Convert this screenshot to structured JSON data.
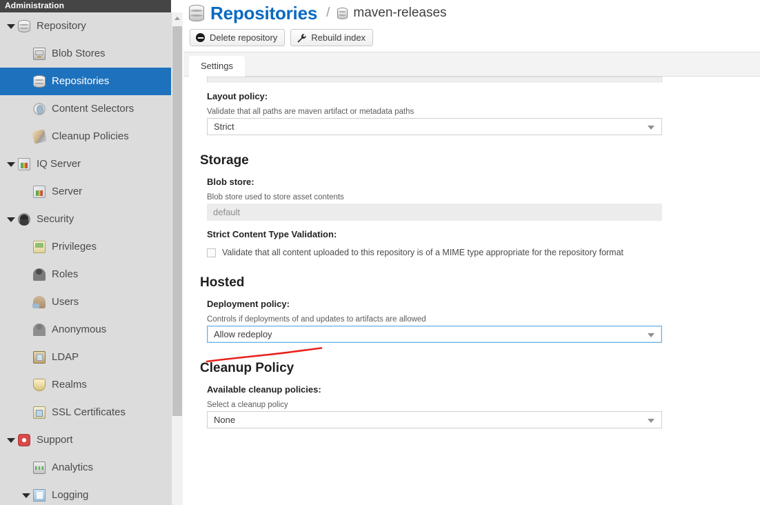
{
  "sidebar": {
    "header": "Administration",
    "items": [
      {
        "label": "Repository",
        "icon": "database-icon",
        "level": 0,
        "twisty": true,
        "selected": false
      },
      {
        "label": "Blob Stores",
        "icon": "blob-store-icon",
        "level": 1,
        "twisty": false,
        "selected": false
      },
      {
        "label": "Repositories",
        "icon": "database-icon",
        "level": 1,
        "twisty": false,
        "selected": true
      },
      {
        "label": "Content Selectors",
        "icon": "selector-icon",
        "level": 1,
        "twisty": false,
        "selected": false
      },
      {
        "label": "Cleanup Policies",
        "icon": "brush-icon",
        "level": 1,
        "twisty": false,
        "selected": false
      },
      {
        "label": "IQ Server",
        "icon": "iq-server-icon",
        "level": 0,
        "twisty": true,
        "selected": false
      },
      {
        "label": "Server",
        "icon": "server-icon",
        "level": 1,
        "twisty": false,
        "selected": false
      },
      {
        "label": "Security",
        "icon": "security-icon",
        "level": 0,
        "twisty": true,
        "selected": false
      },
      {
        "label": "Privileges",
        "icon": "privileges-icon",
        "level": 1,
        "twisty": false,
        "selected": false
      },
      {
        "label": "Roles",
        "icon": "roles-icon",
        "level": 1,
        "twisty": false,
        "selected": false
      },
      {
        "label": "Users",
        "icon": "users-icon",
        "level": 1,
        "twisty": false,
        "selected": false
      },
      {
        "label": "Anonymous",
        "icon": "anonymous-icon",
        "level": 1,
        "twisty": false,
        "selected": false
      },
      {
        "label": "LDAP",
        "icon": "ldap-icon",
        "level": 1,
        "twisty": false,
        "selected": false
      },
      {
        "label": "Realms",
        "icon": "realms-icon",
        "level": 1,
        "twisty": false,
        "selected": false
      },
      {
        "label": "SSL Certificates",
        "icon": "ssl-icon",
        "level": 1,
        "twisty": false,
        "selected": false
      },
      {
        "label": "Support",
        "icon": "support-icon",
        "level": 0,
        "twisty": true,
        "selected": false
      },
      {
        "label": "Analytics",
        "icon": "analytics-icon",
        "level": 1,
        "twisty": false,
        "selected": false
      },
      {
        "label": "Logging",
        "icon": "logging-icon",
        "level": 2,
        "twisty": true,
        "selected": false
      }
    ]
  },
  "breadcrumb": {
    "title": "Repositories",
    "separator": "/",
    "subtitle": "maven-releases"
  },
  "actions": {
    "delete_label": "Delete repository",
    "rebuild_label": "Rebuild index"
  },
  "tabs": [
    {
      "label": "Settings",
      "active": true
    }
  ],
  "form": {
    "layout_policy": {
      "label": "Layout policy:",
      "hint": "Validate that all paths are maven artifact or metadata paths",
      "value": "Strict"
    },
    "storage_heading": "Storage",
    "blob_store": {
      "label": "Blob store:",
      "hint": "Blob store used to store asset contents",
      "value": "default",
      "disabled": true
    },
    "strict_content": {
      "label": "Strict Content Type Validation:",
      "checkbox_label": "Validate that all content uploaded to this repository is of a MIME type appropriate for the repository format",
      "checked": false
    },
    "hosted_heading": "Hosted",
    "deployment_policy": {
      "label": "Deployment policy:",
      "hint": "Controls if deployments of and updates to artifacts are allowed",
      "value": "Allow redeploy",
      "focused": true,
      "annotated": true
    },
    "cleanup_heading": "Cleanup Policy",
    "cleanup_policy": {
      "label": "Available cleanup policies:",
      "hint": "Select a cleanup policy",
      "value": "None"
    }
  },
  "annotation": {
    "type": "underline-stroke",
    "color": "#e8221b"
  },
  "colors": {
    "sidebar_bg": "#dcdcdc",
    "sidebar_header_bg": "#454545",
    "selected_bg": "#1e72bd",
    "title_blue": "#0969c3",
    "tabbar_bg": "#f3f3f3",
    "annotation_red": "#e8221b",
    "focus_blue": "#6cb3e8"
  }
}
